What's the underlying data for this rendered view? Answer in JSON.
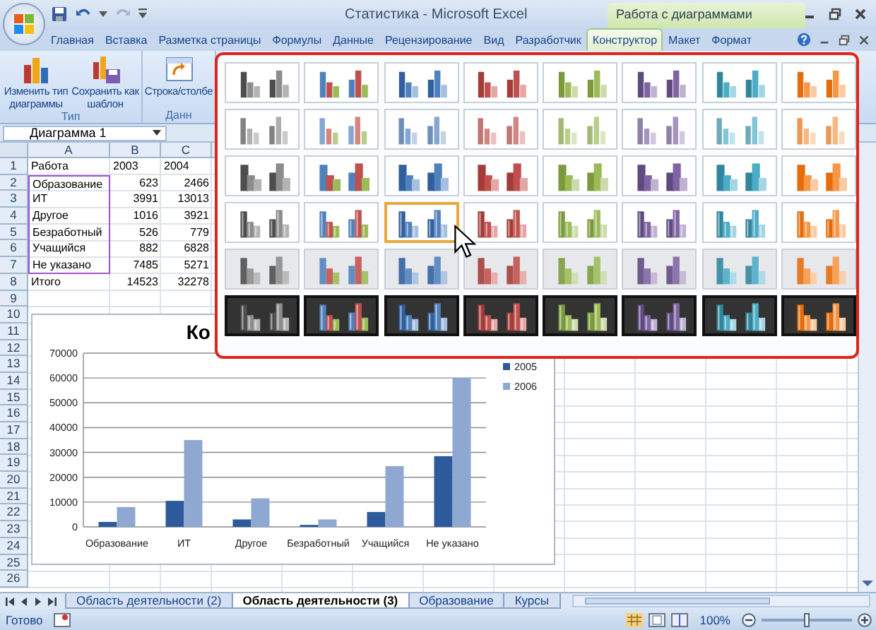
{
  "window": {
    "title": "Статистика - Microsoft Excel",
    "context_group": "Работа с диаграммами"
  },
  "tabs": [
    {
      "label": "Главная",
      "selected": false
    },
    {
      "label": "Вставка",
      "selected": false
    },
    {
      "label": "Разметка страницы",
      "selected": false
    },
    {
      "label": "Формулы",
      "selected": false
    },
    {
      "label": "Данные",
      "selected": false
    },
    {
      "label": "Рецензирование",
      "selected": false
    },
    {
      "label": "Вид",
      "selected": false
    },
    {
      "label": "Разработчик",
      "selected": false
    },
    {
      "label": "Конструктор",
      "selected": true
    },
    {
      "label": "Макет",
      "selected": false
    },
    {
      "label": "Формат",
      "selected": false
    }
  ],
  "ribbon": {
    "groups": [
      {
        "label": "Тип",
        "buttons": [
          {
            "kind": "chart",
            "label": "Изменить тип диаграммы"
          },
          {
            "kind": "save",
            "label": "Сохранить как шаблон"
          }
        ]
      },
      {
        "label": "Данн",
        "buttons": [
          {
            "kind": "switch",
            "label": "Строка/столбе"
          }
        ]
      }
    ]
  },
  "name_box": "Диаграмма 1",
  "sheet": {
    "columns": [
      "A",
      "B",
      "C"
    ],
    "row_numbers": [
      "1",
      "2",
      "3",
      "4",
      "5",
      "6",
      "7",
      "8",
      "9",
      "10",
      "11",
      "12",
      "13",
      "14",
      "15",
      "16",
      "17",
      "18",
      "19",
      "20",
      "21",
      "22",
      "23",
      "24",
      "25",
      "26"
    ],
    "rows": [
      {
        "cells": [
          "Работа",
          "2003",
          "2004"
        ],
        "selected": false
      },
      {
        "cells": [
          "Образование",
          "623",
          "2466"
        ],
        "selected": true
      },
      {
        "cells": [
          "ИТ",
          "3991",
          "13013"
        ],
        "selected": true
      },
      {
        "cells": [
          "Другое",
          "1016",
          "3921"
        ],
        "selected": true
      },
      {
        "cells": [
          "Безработный",
          "526",
          "779"
        ],
        "selected": true
      },
      {
        "cells": [
          "Учащийся",
          "882",
          "6828"
        ],
        "selected": true
      },
      {
        "cells": [
          "Не указано",
          "7485",
          "5271"
        ],
        "selected": true
      },
      {
        "cells": [
          "Итого",
          "14523",
          "32278"
        ],
        "selected": false
      }
    ]
  },
  "chart": {
    "chart_data": {
      "type": "bar",
      "title": "Ко",
      "categories": [
        "Образование",
        "ИТ",
        "Другое",
        "Безработный",
        "Учащийся",
        "Не указано"
      ],
      "series": [
        {
          "name": "2005",
          "color": "#2c5a9a",
          "values": [
            2000,
            10500,
            3000,
            800,
            6000,
            28500
          ]
        },
        {
          "name": "2006",
          "color": "#8fa8d2",
          "values": [
            8000,
            35000,
            11500,
            3000,
            24500,
            60000
          ]
        }
      ],
      "ylim": [
        0,
        70000
      ],
      "yticks": [
        0,
        10000,
        20000,
        30000,
        40000,
        50000,
        60000,
        70000
      ],
      "grid": true,
      "legend": "right"
    }
  },
  "gallery": {
    "rows": [
      {
        "kind": "flat",
        "items": [
          {
            "selected": false
          },
          {
            "selected": false
          },
          {
            "selected": false
          },
          {
            "selected": false
          },
          {
            "selected": false
          },
          {
            "selected": false
          },
          {
            "selected": false
          },
          {
            "selected": false
          }
        ]
      },
      {
        "kind": "light",
        "items": [
          {
            "selected": false
          },
          {
            "selected": false
          },
          {
            "selected": false
          },
          {
            "selected": false
          },
          {
            "selected": false
          },
          {
            "selected": false
          },
          {
            "selected": false
          },
          {
            "selected": false
          }
        ]
      },
      {
        "kind": "solid",
        "items": [
          {
            "selected": false
          },
          {
            "selected": false
          },
          {
            "selected": false
          },
          {
            "selected": false
          },
          {
            "selected": false
          },
          {
            "selected": false
          },
          {
            "selected": false
          },
          {
            "selected": false
          }
        ]
      },
      {
        "kind": "bevel",
        "items": [
          {
            "selected": false
          },
          {
            "selected": false
          },
          {
            "selected": true
          },
          {
            "selected": false
          },
          {
            "selected": false
          },
          {
            "selected": false
          },
          {
            "selected": false
          },
          {
            "selected": false
          }
        ]
      },
      {
        "kind": "tinted",
        "items": [
          {
            "selected": false
          },
          {
            "selected": false
          },
          {
            "selected": false
          },
          {
            "selected": false
          },
          {
            "selected": false
          },
          {
            "selected": false
          },
          {
            "selected": false
          },
          {
            "selected": false
          }
        ]
      },
      {
        "kind": "dark",
        "items": [
          {
            "selected": false
          },
          {
            "selected": false
          },
          {
            "selected": false
          },
          {
            "selected": false
          },
          {
            "selected": false
          },
          {
            "selected": false
          },
          {
            "selected": false
          },
          {
            "selected": false
          }
        ]
      }
    ]
  },
  "sheet_tabs": [
    {
      "label": "Область деятельности (2)",
      "selected": false
    },
    {
      "label": "Область деятельности (3)",
      "selected": true
    },
    {
      "label": "Образование",
      "selected": false
    },
    {
      "label": "Курсы",
      "selected": false
    }
  ],
  "status_bar": {
    "text": "Готово",
    "zoom": "100%",
    "zoom_slider": {
      "level": 0.5
    }
  }
}
